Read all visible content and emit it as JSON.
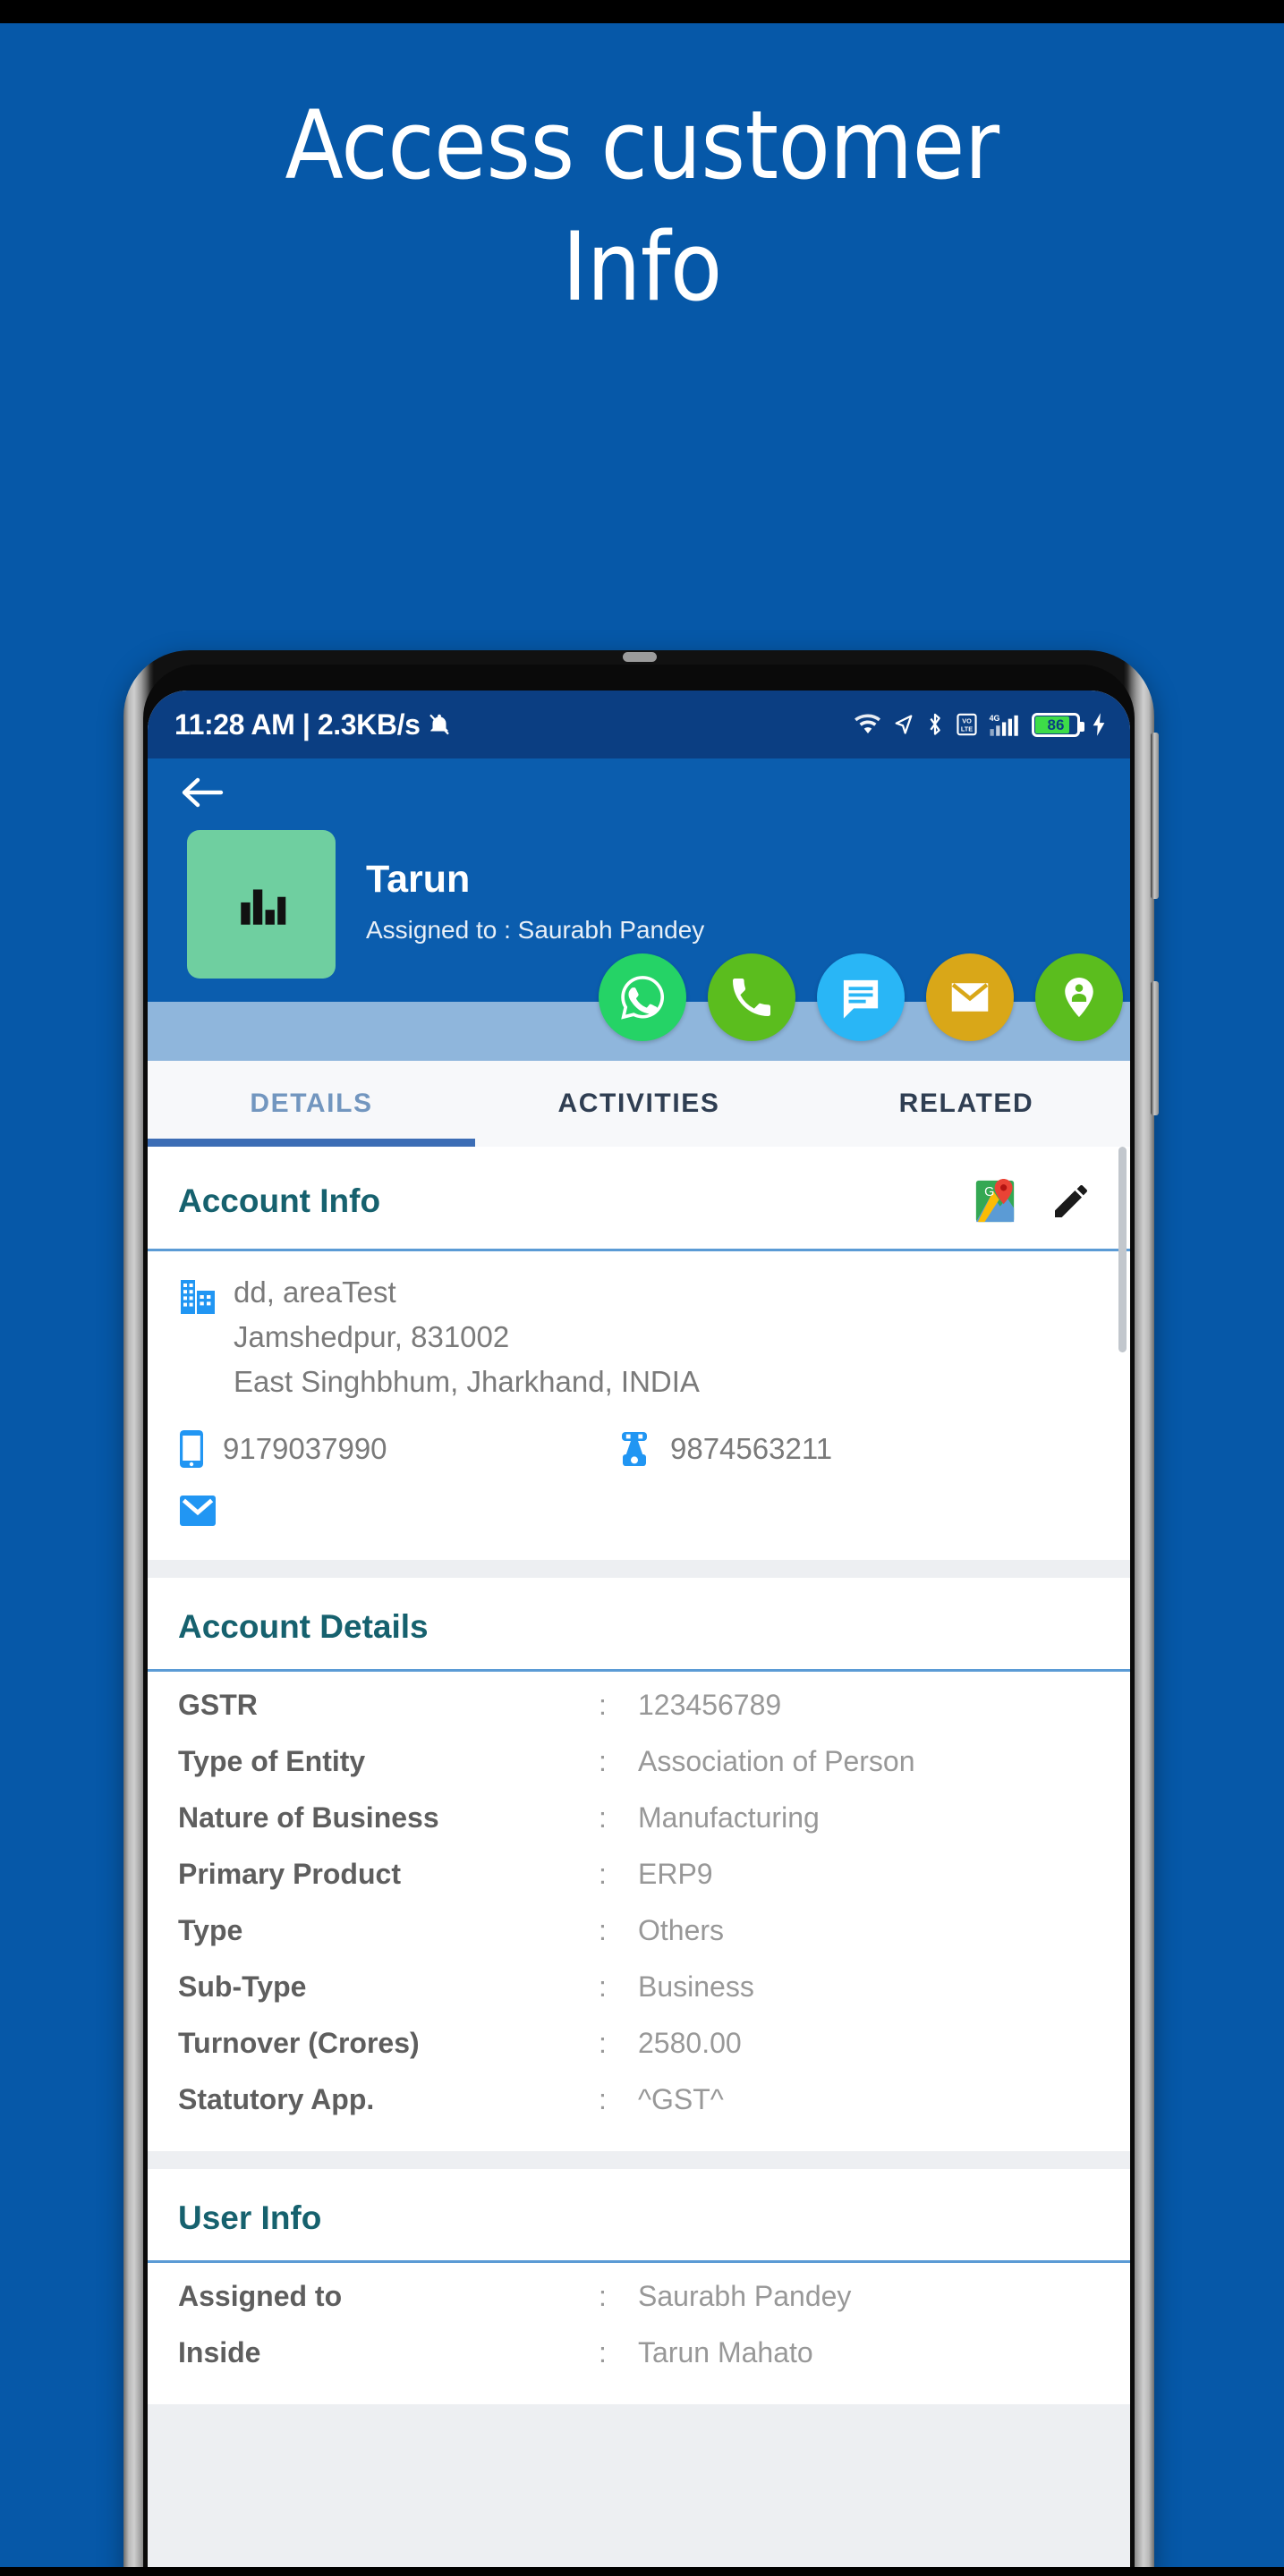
{
  "promo": {
    "title": "Access customer\nInfo",
    "background_color": "#0658A8"
  },
  "statusbar": {
    "time_and_data": "11:28 AM | 2.3KB/s",
    "mute_icon": "bell-muted-icon",
    "wifi_icon": "wifi-icon",
    "location_icon": "location-arrow-icon",
    "bluetooth_icon": "bluetooth-icon",
    "volte_icon": "volte-icon",
    "network_label": "4G",
    "signal_icon": "signal-bars-icon",
    "battery_percent": "86",
    "charging_icon": "charging-bolt-icon",
    "background_color": "#0B3E82"
  },
  "appbar": {
    "back_icon": "back-arrow-icon",
    "avatar_icon": "bar-chart-icon",
    "avatar_color": "#6FCFA0",
    "account_name": "Tarun",
    "assigned_line": "Assigned to : Saurabh Pandey",
    "background_color": "#0B5DAE"
  },
  "quick_actions": [
    {
      "name": "whatsapp-button",
      "icon": "whatsapp-icon",
      "color": "#25D366"
    },
    {
      "name": "call-button",
      "icon": "phone-icon",
      "color": "#5BBD1E"
    },
    {
      "name": "sms-button",
      "icon": "message-icon",
      "color": "#29B6F6"
    },
    {
      "name": "email-button",
      "icon": "envelope-icon",
      "color": "#D9A718"
    },
    {
      "name": "location-button",
      "icon": "map-pin-person-icon",
      "color": "#5BBD1E"
    }
  ],
  "tabs": [
    {
      "label": "DETAILS",
      "active": true
    },
    {
      "label": "ACTIVITIES",
      "active": false
    },
    {
      "label": "RELATED",
      "active": false
    }
  ],
  "account_info": {
    "title": "Account Info",
    "map_icon": "google-maps-icon",
    "edit_icon": "pencil-edit-icon",
    "building_icon": "building-icon",
    "address_line1": "dd, areaTest",
    "address_line2": "Jamshedpur, 831002",
    "address_line3": "East Singhbhum, Jharkhand, INDIA",
    "mobile_icon": "mobile-phone-icon",
    "mobile_number": "9179037990",
    "landline_icon": "telephone-icon",
    "landline_number": "9874563211",
    "email_icon": "envelope-icon"
  },
  "account_details": {
    "title": "Account Details",
    "rows": [
      {
        "key": "GSTR",
        "value": "123456789"
      },
      {
        "key": "Type of Entity",
        "value": "Association of Person"
      },
      {
        "key": "Nature of Business",
        "value": "Manufacturing"
      },
      {
        "key": "Primary Product",
        "value": "ERP9"
      },
      {
        "key": "Type",
        "value": "Others"
      },
      {
        "key": "Sub-Type",
        "value": "Business"
      },
      {
        "key": "Turnover (Crores)",
        "value": "2580.00"
      },
      {
        "key": "Statutory App.",
        "value": "^GST^"
      }
    ]
  },
  "user_info": {
    "title": "User Info",
    "rows": [
      {
        "key": "Assigned to",
        "value": "Saurabh Pandey"
      },
      {
        "key": "Inside",
        "value": "Tarun Mahato"
      }
    ]
  },
  "colors": {
    "promo_blue": "#0658A8",
    "appbar_blue": "#0B5DAE",
    "statusbar_blue": "#0B3E82",
    "teal_heading": "#16616E",
    "divider_blue": "#5B9BD5",
    "tab_active": "#3C6DB5",
    "action_strip": "#8FB6DC"
  }
}
